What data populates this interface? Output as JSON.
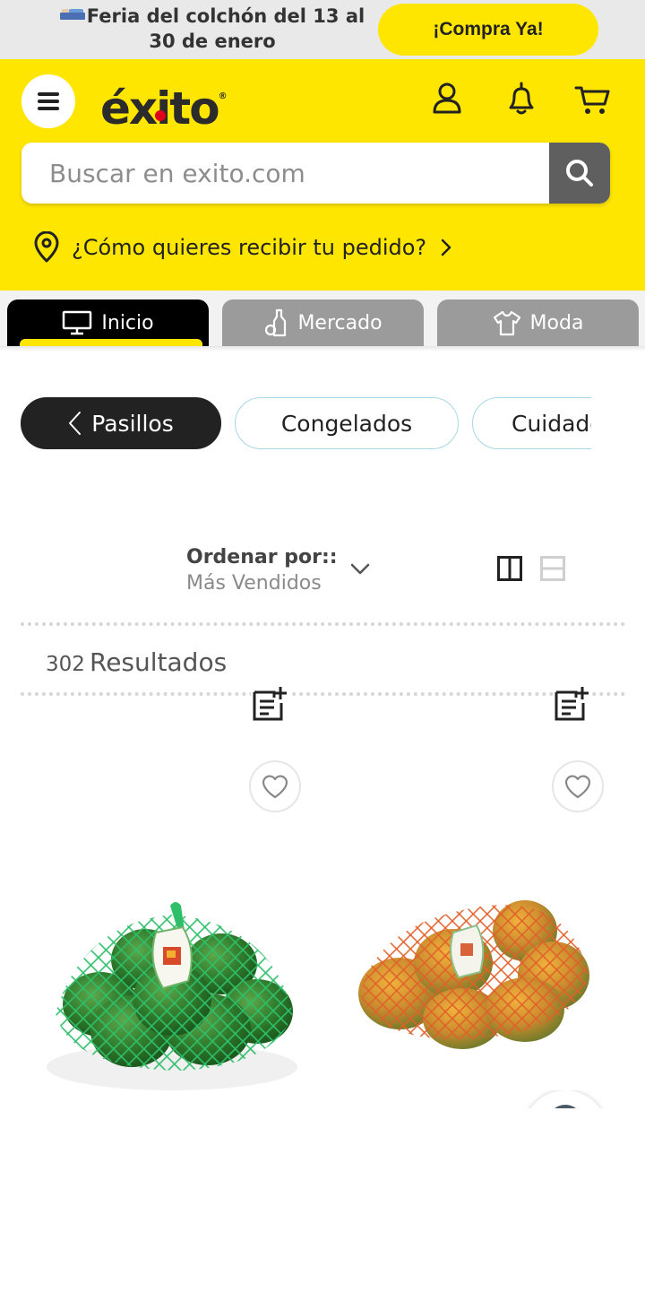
{
  "promo": {
    "text": "Feria del colchón del 13 al 30 de enero",
    "icon": "bed-icon",
    "button_label": "¡Compra Ya!"
  },
  "header": {
    "logo_text": "éxito",
    "logo_mark": "®",
    "search_placeholder": "Buscar en exito.com",
    "delivery_prompt": "¿Cómo quieres recibir tu pedido?",
    "icons": [
      "menu-icon",
      "user-icon",
      "bell-icon",
      "cart-icon",
      "search-icon",
      "location-pin-icon",
      "chevron-right-icon"
    ],
    "brand_color": "#ffe600"
  },
  "tabs": [
    {
      "label": "Inicio",
      "icon": "monitor-icon",
      "active": true
    },
    {
      "label": "Mercado",
      "icon": "bottle-icon",
      "active": false
    },
    {
      "label": "Moda",
      "icon": "shirt-icon",
      "active": false
    }
  ],
  "chips": {
    "back_label": "Pasillos",
    "items": [
      "Congelados",
      "Cuidado"
    ]
  },
  "sort": {
    "label": "Ordenar por::",
    "value": "Más Vendidos"
  },
  "results": {
    "count": "302",
    "label": "Resultados"
  },
  "products": [
    {
      "image": "green lemons in net bag",
      "icons": [
        "add-to-list-icon",
        "heart-icon"
      ]
    },
    {
      "image": "mangoes in net bag",
      "icons": [
        "add-to-list-icon",
        "heart-icon"
      ]
    }
  ]
}
